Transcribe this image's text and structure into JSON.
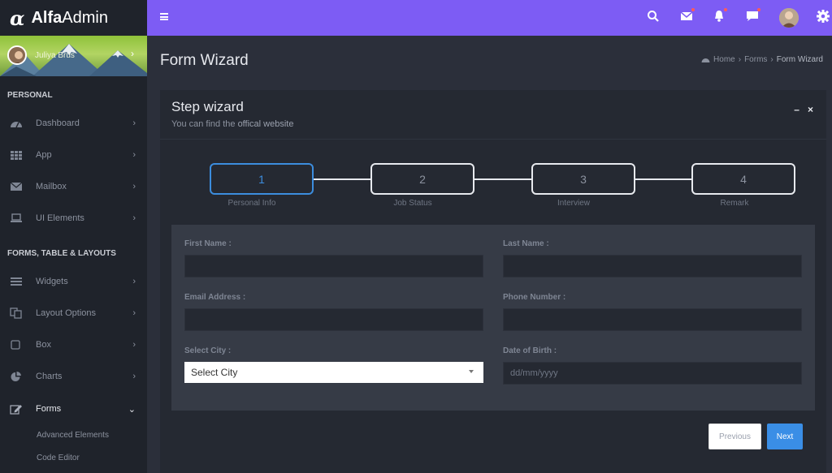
{
  "brand": {
    "name_bold": "Alfa",
    "name_regular": "Admin"
  },
  "user": {
    "name": "Juliya Brus"
  },
  "sidebar": {
    "sections": [
      {
        "header": "PERSONAL"
      },
      {
        "header": "FORMS, TABLE & LAYOUTS"
      }
    ],
    "items": [
      {
        "label": "Dashboard",
        "icon": "dashboard-icon"
      },
      {
        "label": "App",
        "icon": "grid-icon"
      },
      {
        "label": "Mailbox",
        "icon": "envelope-icon"
      },
      {
        "label": "UI Elements",
        "icon": "laptop-icon"
      },
      {
        "label": "Widgets",
        "icon": "bars-icon"
      },
      {
        "label": "Layout Options",
        "icon": "files-icon"
      },
      {
        "label": "Box",
        "icon": "square-icon"
      },
      {
        "label": "Charts",
        "icon": "pie-chart-icon"
      },
      {
        "label": "Forms",
        "icon": "edit-icon"
      }
    ],
    "submenu": [
      {
        "label": "Advanced Elements"
      },
      {
        "label": "Code Editor"
      }
    ]
  },
  "page": {
    "title": "Form Wizard",
    "breadcrumb": [
      "Home",
      "Forms",
      "Form Wizard"
    ]
  },
  "card": {
    "title": "Step wizard",
    "subtitle_prefix": "You can find the",
    "subtitle_link": "offical website"
  },
  "wizard": {
    "steps": [
      {
        "number": "1",
        "label": "Personal Info"
      },
      {
        "number": "2",
        "label": "Job Status"
      },
      {
        "number": "3",
        "label": "Interview"
      },
      {
        "number": "4",
        "label": "Remark"
      }
    ]
  },
  "form": {
    "first_name_label": "First Name :",
    "last_name_label": "Last Name :",
    "email_label": "Email Address :",
    "phone_label": "Phone Number :",
    "city_label": "Select City :",
    "city_value": "Select City",
    "dob_label": "Date of Birth :",
    "dob_placeholder": "dd/mm/yyyy"
  },
  "buttons": {
    "previous": "Previous",
    "next": "Next"
  },
  "colors": {
    "topbar": "#7d5cf4",
    "accent": "#3c8dde",
    "next_button": "#3a8ee6",
    "notification_dot": "#ff5a5a"
  }
}
